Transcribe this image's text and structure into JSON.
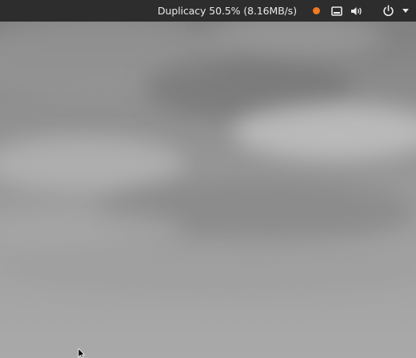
{
  "top_bar": {
    "duplicacy_status": "Duplicacy 50.5% (8.16MB/s)",
    "indicators": [
      {
        "name": "status-dot-icon",
        "color": "#f07b21"
      },
      {
        "name": "tray-icon"
      },
      {
        "name": "volume-icon"
      },
      {
        "name": "power-icon"
      },
      {
        "name": "chevron-down-icon"
      }
    ]
  },
  "wallpaper": {
    "description_colors": [
      "#7d7d7d",
      "#9a9a9a",
      "#a9a9a9"
    ]
  }
}
